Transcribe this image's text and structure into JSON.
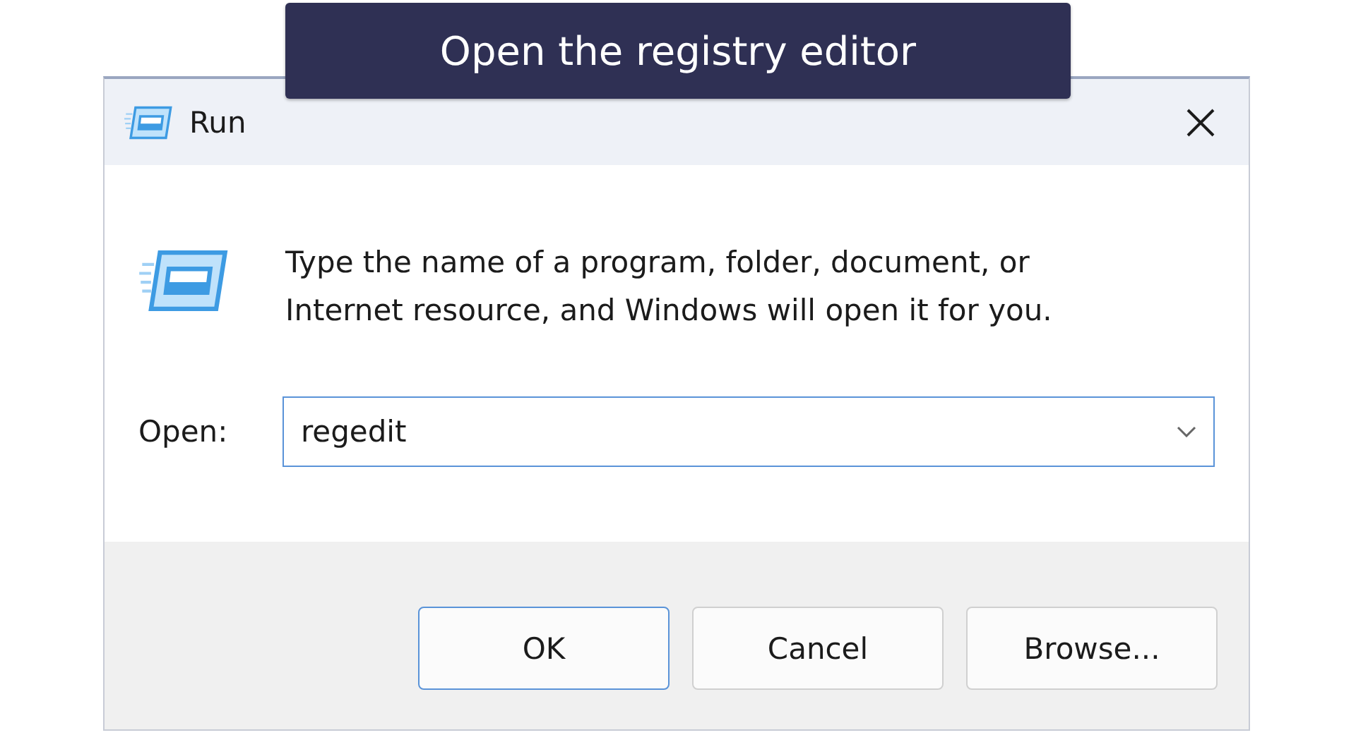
{
  "banner": {
    "text": "Open the registry editor"
  },
  "window": {
    "title": "Run"
  },
  "prompt": "Type the name of a program, folder, document, or Internet resource, and Windows will open it for you.",
  "open_field": {
    "label": "Open:",
    "value": "regedit"
  },
  "buttons": [
    {
      "label": "OK",
      "default": true
    },
    {
      "label": "Cancel",
      "default": false
    },
    {
      "label": "Browse...",
      "default": false
    }
  ]
}
